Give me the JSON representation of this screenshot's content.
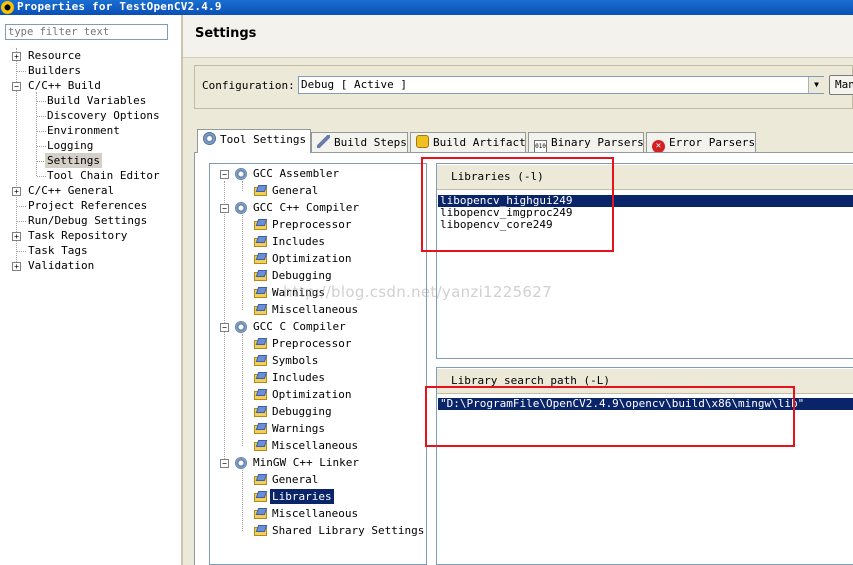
{
  "window": {
    "title": "Properties for TestOpenCV2.4.9"
  },
  "filter": {
    "placeholder": "type filter text"
  },
  "left_tree": [
    {
      "label": "Resource",
      "expandable": true
    },
    {
      "label": "Builders"
    },
    {
      "label": "C/C++ Build",
      "expanded": true
    },
    {
      "label": "Build Variables"
    },
    {
      "label": "Discovery Options"
    },
    {
      "label": "Environment"
    },
    {
      "label": "Logging"
    },
    {
      "label": "Settings",
      "selected": true
    },
    {
      "label": "Tool Chain Editor"
    },
    {
      "label": "C/C++ General",
      "expandable": true
    },
    {
      "label": "Project References"
    },
    {
      "label": "Run/Debug Settings"
    },
    {
      "label": "Task Repository",
      "expandable": true
    },
    {
      "label": "Task Tags"
    },
    {
      "label": "Validation",
      "expandable": true
    }
  ],
  "settings": {
    "title": "Settings",
    "configuration_label": "Configuration:",
    "configuration_value": "Debug  [ Active ]",
    "manage_label": "Manage..."
  },
  "tabs": [
    {
      "label": "Tool Settings",
      "icon": "gear-icon",
      "active": true
    },
    {
      "label": "Build Steps",
      "icon": "wrench-icon"
    },
    {
      "label": "Build Artifact",
      "icon": "artifact-icon"
    },
    {
      "label": "Binary Parsers",
      "icon": "binary-icon"
    },
    {
      "label": "Error Parsers",
      "icon": "error-icon"
    }
  ],
  "tool_tree": [
    {
      "label": "GCC Assembler",
      "type": "tool"
    },
    {
      "label": "General",
      "type": "option"
    },
    {
      "label": "GCC C++ Compiler",
      "type": "tool"
    },
    {
      "label": "Preprocessor",
      "type": "option"
    },
    {
      "label": "Includes",
      "type": "option"
    },
    {
      "label": "Optimization",
      "type": "option"
    },
    {
      "label": "Debugging",
      "type": "option"
    },
    {
      "label": "Warnings",
      "type": "option"
    },
    {
      "label": "Miscellaneous",
      "type": "option"
    },
    {
      "label": "GCC C Compiler",
      "type": "tool"
    },
    {
      "label": "Preprocessor",
      "type": "option"
    },
    {
      "label": "Symbols",
      "type": "option"
    },
    {
      "label": "Includes",
      "type": "option"
    },
    {
      "label": "Optimization",
      "type": "option"
    },
    {
      "label": "Debugging",
      "type": "option"
    },
    {
      "label": "Warnings",
      "type": "option"
    },
    {
      "label": "Miscellaneous",
      "type": "option"
    },
    {
      "label": "MinGW C++ Linker",
      "type": "tool"
    },
    {
      "label": "General",
      "type": "option"
    },
    {
      "label": "Libraries",
      "type": "option",
      "selected": true
    },
    {
      "label": "Miscellaneous",
      "type": "option"
    },
    {
      "label": "Shared Library Settings",
      "type": "option"
    }
  ],
  "libraries": {
    "header": "Libraries (-l)",
    "items": [
      "libopencv_highgui249",
      "libopencv_imgproc249",
      "libopencv_core249"
    ]
  },
  "library_paths": {
    "header": "Library search path (-L)",
    "items": [
      "\"D:\\ProgramFile\\OpenCV2.4.9\\opencv\\build\\x86\\mingw\\lib\""
    ]
  },
  "watermark": "http://blog.csdn.net/yanzi1225627",
  "colors": {
    "selection": "#0a246a",
    "annotation_red": "#e8121c",
    "titlebar": "#0a4fb5"
  }
}
